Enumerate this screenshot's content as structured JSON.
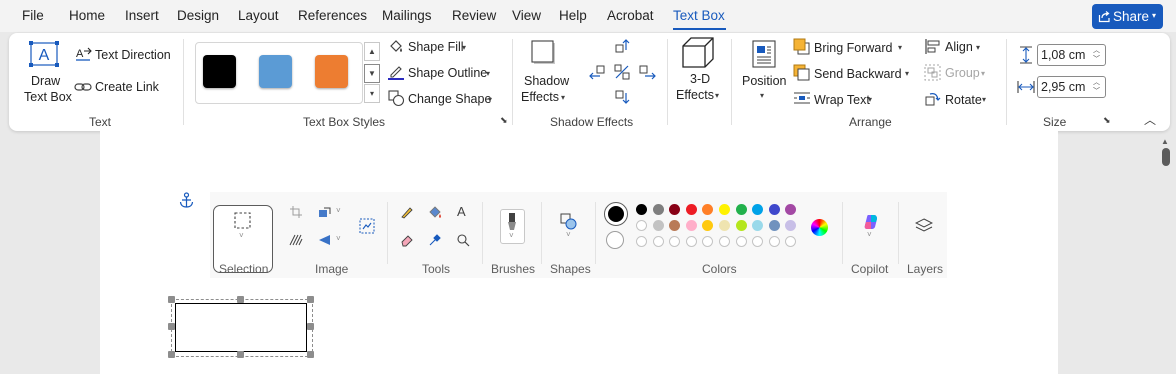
{
  "menu": {
    "items": [
      "File",
      "Home",
      "Insert",
      "Design",
      "Layout",
      "References",
      "Mailings",
      "Review",
      "View",
      "Help",
      "Acrobat",
      "Text Box"
    ],
    "active": "Text Box",
    "share_label": "Share"
  },
  "ribbon": {
    "text_group": {
      "label": "Text",
      "draw_text_box": [
        "Draw",
        "Text Box"
      ],
      "text_direction": "Text Direction",
      "create_link": "Create Link"
    },
    "styles_group": {
      "label": "Text Box Styles",
      "swatches": [
        "#000000",
        "#5B9BD5",
        "#ED7D31"
      ],
      "shape_fill": "Shape Fill",
      "shape_outline": "Shape Outline",
      "change_shape": "Change Shape"
    },
    "shadow_group": {
      "label": "Shadow Effects",
      "shadow_effects": [
        "Shadow",
        "Effects"
      ]
    },
    "threed_group": {
      "threed_effects": [
        "3-D",
        "Effects"
      ]
    },
    "arrange_group": {
      "label": "Arrange",
      "position": "Position",
      "bring_forward": "Bring Forward",
      "send_backward": "Send Backward",
      "wrap_text": "Wrap Text",
      "align": "Align",
      "group": "Group",
      "rotate": "Rotate"
    },
    "size_group": {
      "label": "Size",
      "height": "1,08 cm",
      "width": "2,95 cm"
    }
  },
  "paint_toolbar": {
    "labels": {
      "selection": "Selection",
      "image": "Image",
      "tools": "Tools",
      "brushes": "Brushes",
      "shapes": "Shapes",
      "colors": "Colors",
      "copilot": "Copilot",
      "layers": "Layers"
    },
    "colors_row1": [
      "#000000",
      "#7F7F7F",
      "#880015",
      "#ED1C24",
      "#FF7F27",
      "#FFF200",
      "#22B14C",
      "#00A2E8",
      "#3F48CC",
      "#A349A4"
    ],
    "colors_row2": [
      "#FFFFFF",
      "#C3C3C3",
      "#B97A57",
      "#FFAEC9",
      "#FFC90E",
      "#EFE4B0",
      "#B5E61D",
      "#99D9EA",
      "#7092BE",
      "#C8BFE7"
    ],
    "accent": "#185ABD"
  }
}
